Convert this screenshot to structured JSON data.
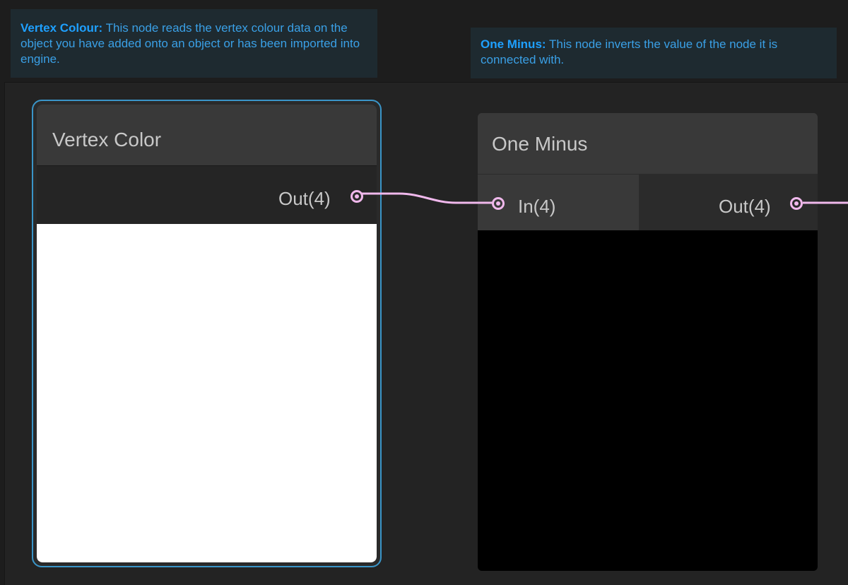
{
  "notes": {
    "vertex": {
      "title": "Vertex Colour:",
      "text": " This node reads the vertex colour data on the object you have added onto an object or has been imported into engine."
    },
    "one_minus": {
      "title": "One Minus:",
      "text": " This node inverts the value of the node it is connected with."
    }
  },
  "nodes": {
    "vertex_color": {
      "title": "Vertex Color",
      "output_label": "Out(4)",
      "preview_color": "#ffffff",
      "selected": true
    },
    "one_minus": {
      "title": "One Minus",
      "input_label": "In(4)",
      "output_label": "Out(4)",
      "preview_color": "#000000"
    }
  },
  "colors": {
    "accent": "#3a95c8",
    "edge": "#f0b8ec",
    "note_text": "#1ea0ff"
  }
}
